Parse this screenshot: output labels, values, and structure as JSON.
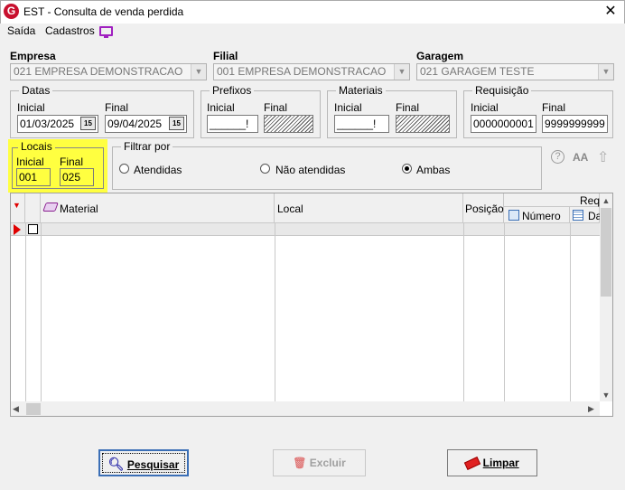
{
  "window": {
    "title": "EST - Consulta de venda perdida",
    "logo_letter": "G",
    "close": "✕"
  },
  "menu": {
    "items": [
      "Saída",
      "Cadastros"
    ]
  },
  "empresa": {
    "label": "Empresa",
    "value": "021 EMPRESA DEMONSTRACAO"
  },
  "filial": {
    "label": "Filial",
    "value": "001 EMPRESA DEMONSTRACAO"
  },
  "garagem": {
    "label": "Garagem",
    "value": "021 GARAGEM TESTE"
  },
  "datas": {
    "title": "Datas",
    "inicial_label": "Inicial",
    "final_label": "Final",
    "inicial": "01/03/2025",
    "final": "09/04/2025",
    "cal": "15"
  },
  "prefixos": {
    "title": "Prefixos",
    "inicial_label": "Inicial",
    "final_label": "Final",
    "inicial": "______!"
  },
  "materiais": {
    "title": "Materiais",
    "inicial_label": "Inicial",
    "final_label": "Final",
    "inicial": "______!"
  },
  "requisicao": {
    "title": "Requisição",
    "inicial_label": "Inicial",
    "final_label": "Final",
    "inicial": "0000000001",
    "final": "9999999999"
  },
  "locais": {
    "title": "Locais",
    "inicial_label": "Inicial",
    "final_label": "Final",
    "inicial": "001",
    "final": "025",
    "highlight": "#ffff40"
  },
  "filtro": {
    "title": "Filtrar por",
    "options": [
      "Atendidas",
      "Não atendidas",
      "Ambas"
    ],
    "selected": "Ambas"
  },
  "tools": {
    "help": "?",
    "font": "AA",
    "up": "⇧"
  },
  "grid": {
    "columns": {
      "material": "Material",
      "local": "Local",
      "posicao": "Posição",
      "requisicao_group": "Requ",
      "numero": "Número",
      "data": "Da"
    }
  },
  "buttons": {
    "pesquisar": "Pesquisar",
    "excluir": "Excluir",
    "limpar": "Limpar"
  },
  "colors": {
    "accent": "#3b6fb6",
    "highlight": "#ffff40",
    "marker": "#e00000"
  }
}
